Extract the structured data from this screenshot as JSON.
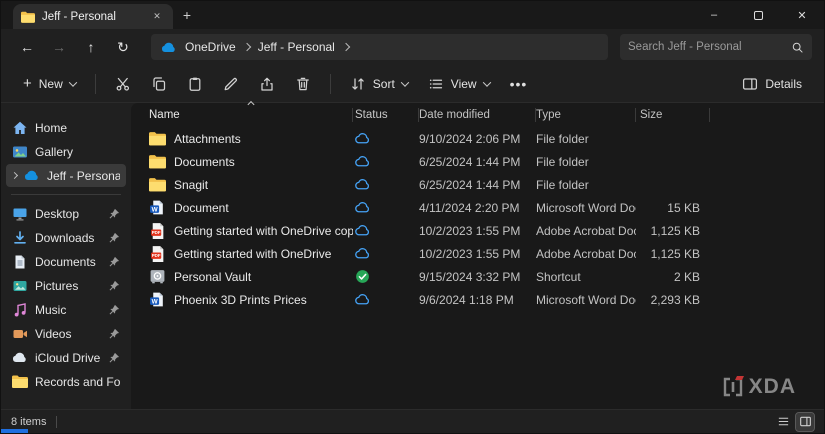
{
  "window": {
    "tab_title": "Jeff - Personal",
    "controls": {
      "minimize_glyph": "–",
      "close_glyph": "✕",
      "tab_close_glyph": "✕",
      "new_tab_glyph": "+"
    }
  },
  "navigation": {
    "icons": {
      "back": "←",
      "forward": "→",
      "up": "↑",
      "refresh": "↻"
    },
    "breadcrumb": [
      {
        "label": "OneDrive"
      },
      {
        "label": "Jeff - Personal"
      }
    ],
    "search_placeholder": "Search Jeff - Personal"
  },
  "toolbar": {
    "new_label": "New",
    "new_plus_glyph": "+",
    "sort_label": "Sort",
    "view_label": "View",
    "more_glyph": "•••",
    "details_label": "Details"
  },
  "sidebar": {
    "items": [
      {
        "label": "Home",
        "icon": "home",
        "pinned": false,
        "selected": false
      },
      {
        "label": "Gallery",
        "icon": "gallery",
        "pinned": false,
        "selected": false
      },
      {
        "label": "Jeff - Personal",
        "icon": "onedrive-cloud",
        "pinned": false,
        "selected": true
      },
      {
        "label": "Desktop",
        "icon": "desktop",
        "pinned": true,
        "selected": false
      },
      {
        "label": "Downloads",
        "icon": "downloads",
        "pinned": true,
        "selected": false
      },
      {
        "label": "Documents",
        "icon": "documents",
        "pinned": true,
        "selected": false
      },
      {
        "label": "Pictures",
        "icon": "pictures",
        "pinned": true,
        "selected": false
      },
      {
        "label": "Music",
        "icon": "music",
        "pinned": true,
        "selected": false
      },
      {
        "label": "Videos",
        "icon": "videos",
        "pinned": true,
        "selected": false
      },
      {
        "label": "iCloud Drive",
        "icon": "icloud",
        "pinned": true,
        "selected": false
      },
      {
        "label": "Records and For",
        "icon": "folder",
        "pinned": false,
        "selected": false
      }
    ]
  },
  "file_list": {
    "columns": [
      "Name",
      "Status",
      "Date modified",
      "Type",
      "Size"
    ],
    "rows": [
      {
        "name": "Attachments",
        "icon": "folder",
        "status": "cloud",
        "date": "9/10/2024 2:06 PM",
        "type": "File folder",
        "size": ""
      },
      {
        "name": "Documents",
        "icon": "folder",
        "status": "cloud",
        "date": "6/25/2024 1:44 PM",
        "type": "File folder",
        "size": ""
      },
      {
        "name": "Snagit",
        "icon": "folder",
        "status": "cloud",
        "date": "6/25/2024 1:44 PM",
        "type": "File folder",
        "size": ""
      },
      {
        "name": "Document",
        "icon": "word",
        "status": "cloud",
        "date": "4/11/2024 2:20 PM",
        "type": "Microsoft Word Doc...",
        "size": "15 KB"
      },
      {
        "name": "Getting started with OneDrive copy",
        "icon": "pdf",
        "status": "cloud",
        "date": "10/2/2023 1:55 PM",
        "type": "Adobe Acrobat Docu...",
        "size": "1,125 KB"
      },
      {
        "name": "Getting started with OneDrive",
        "icon": "pdf",
        "status": "cloud",
        "date": "10/2/2023 1:55 PM",
        "type": "Adobe Acrobat Docu...",
        "size": "1,125 KB"
      },
      {
        "name": "Personal Vault",
        "icon": "vault",
        "status": "synced",
        "date": "9/15/2024 3:32 PM",
        "type": "Shortcut",
        "size": "2 KB"
      },
      {
        "name": "Phoenix 3D Prints Prices",
        "icon": "word",
        "status": "cloud",
        "date": "9/6/2024 1:18 PM",
        "type": "Microsoft Word Doc...",
        "size": "2,293 KB"
      }
    ]
  },
  "status_bar": {
    "count": "8 items"
  },
  "watermark": {
    "text": "XDA"
  }
}
